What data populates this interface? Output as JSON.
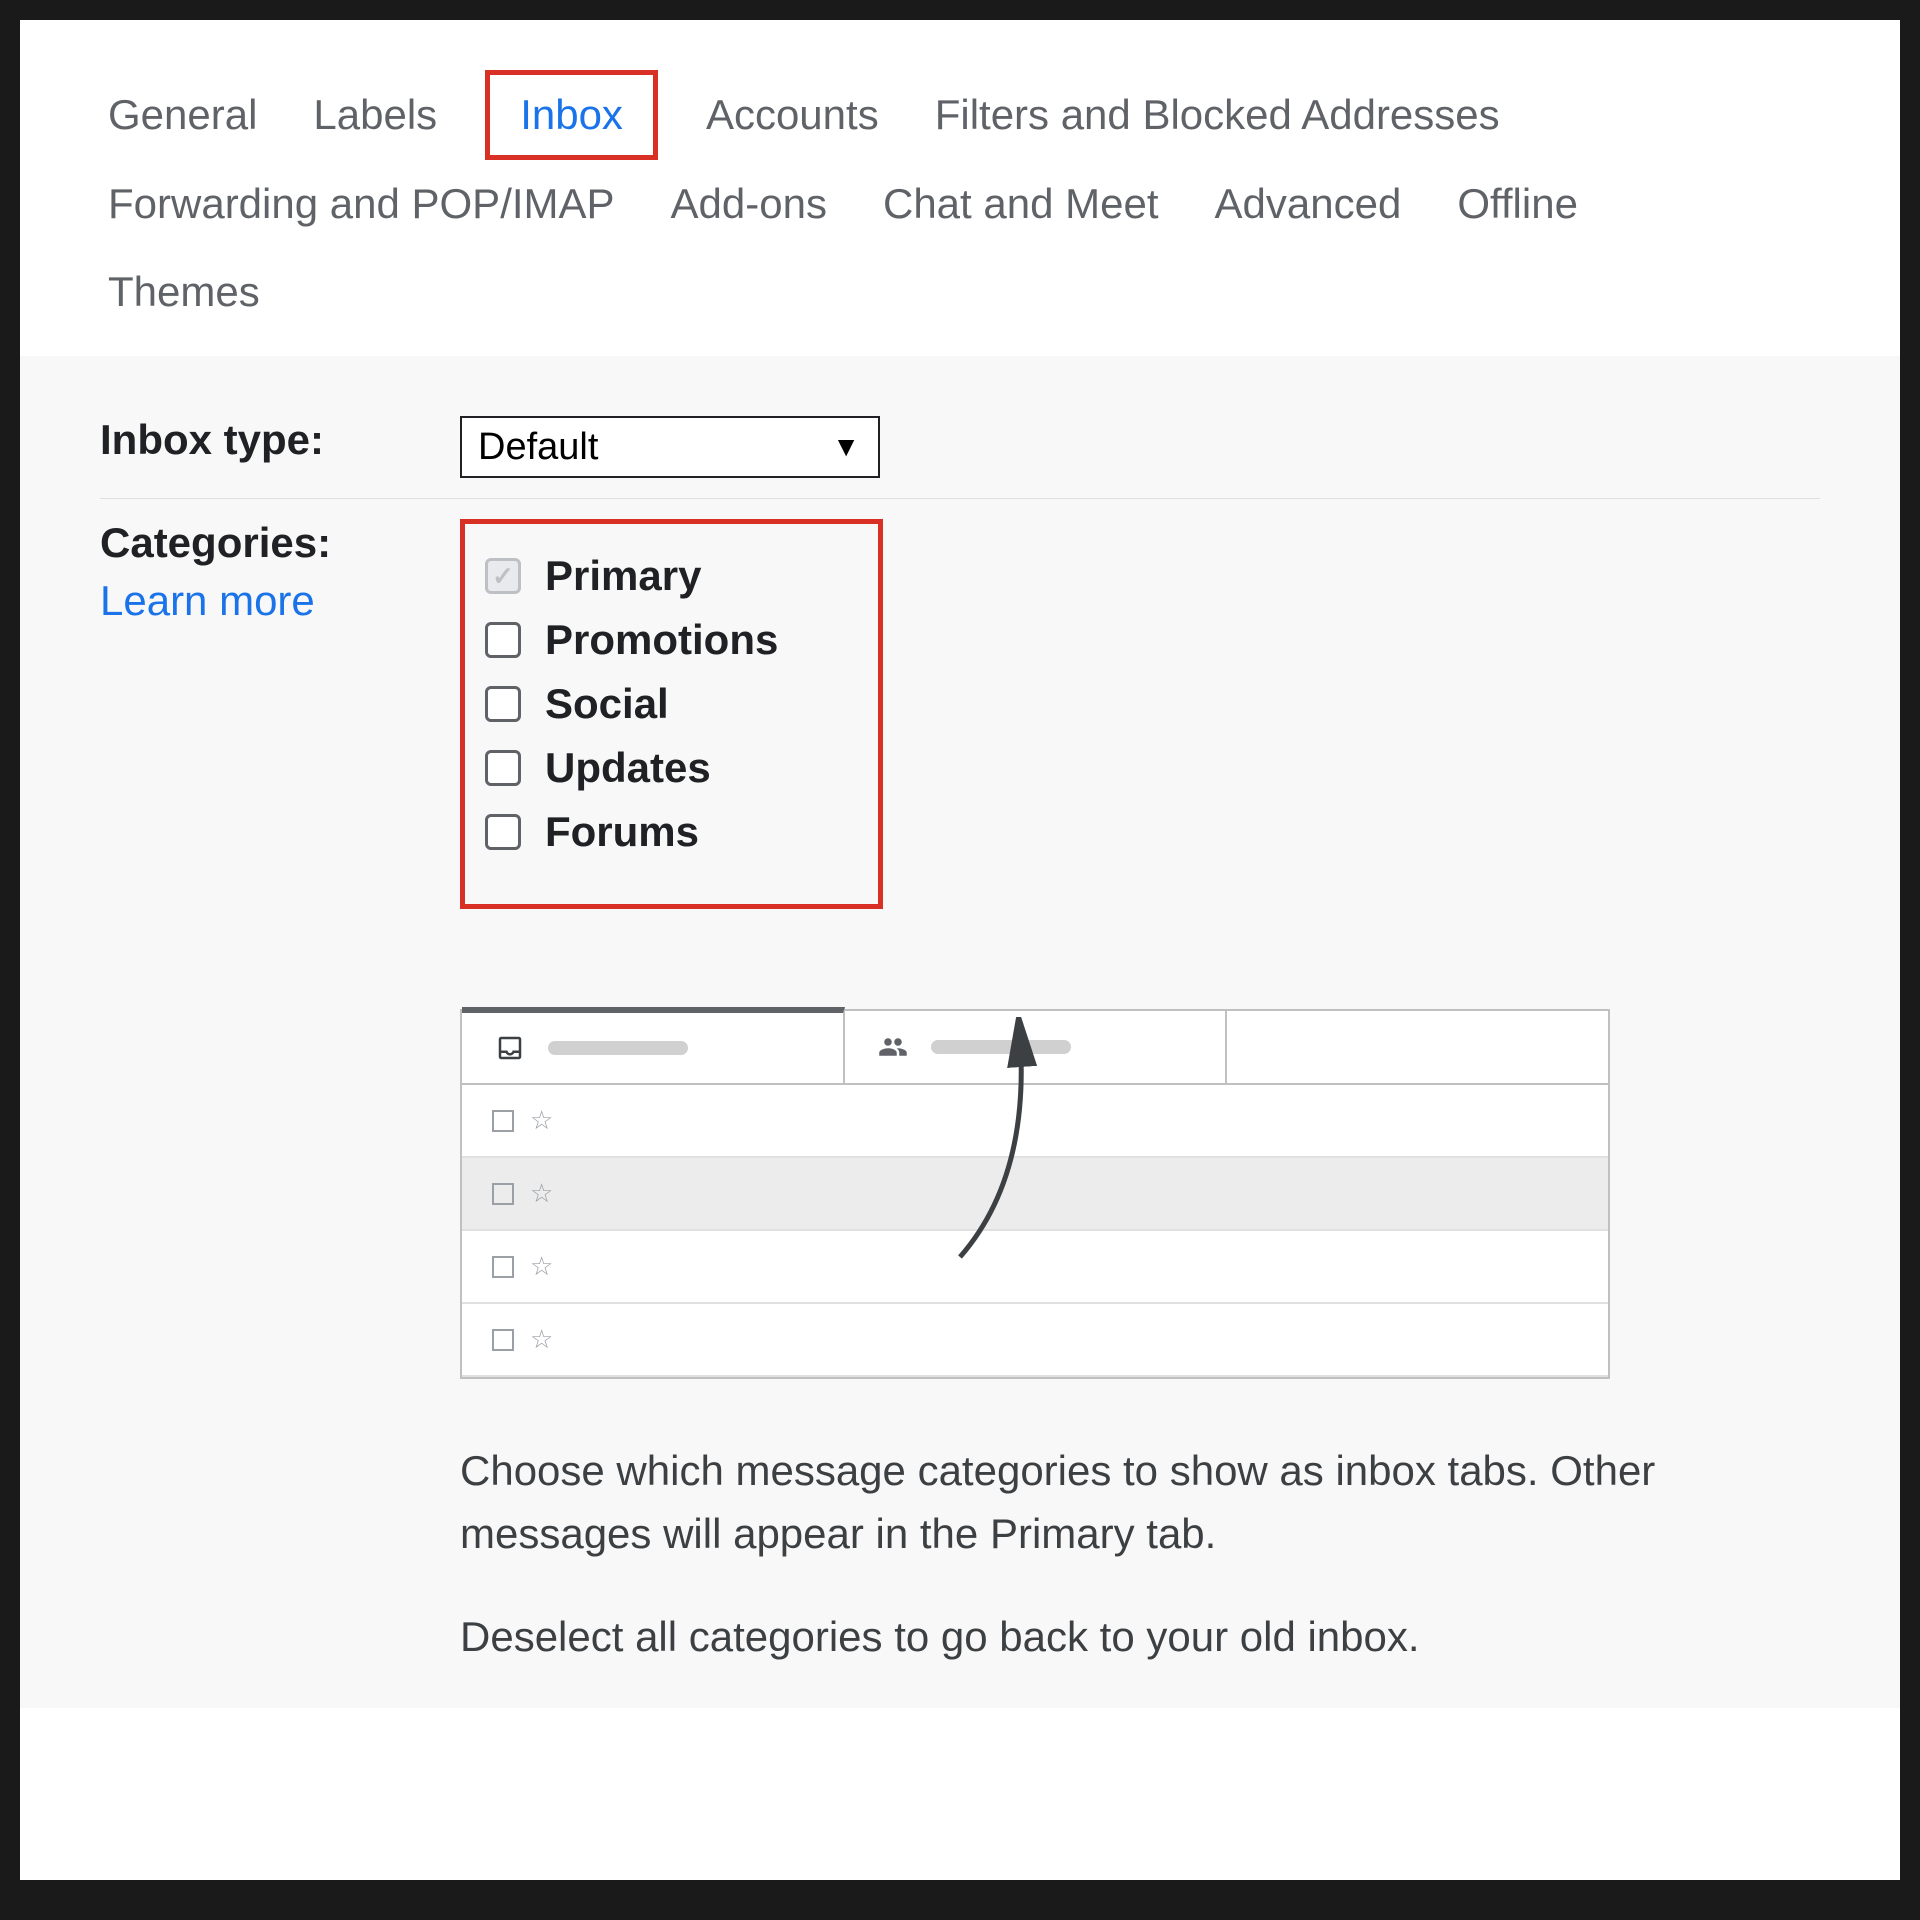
{
  "tabs": {
    "items": [
      {
        "label": "General",
        "active": false
      },
      {
        "label": "Labels",
        "active": false
      },
      {
        "label": "Inbox",
        "active": true
      },
      {
        "label": "Accounts",
        "active": false
      },
      {
        "label": "Filters and Blocked Addresses",
        "active": false
      },
      {
        "label": "Forwarding and POP/IMAP",
        "active": false
      },
      {
        "label": "Add-ons",
        "active": false
      },
      {
        "label": "Chat and Meet",
        "active": false
      },
      {
        "label": "Advanced",
        "active": false
      },
      {
        "label": "Offline",
        "active": false
      },
      {
        "label": "Themes",
        "active": false
      }
    ]
  },
  "inbox_type": {
    "label": "Inbox type:",
    "selected": "Default"
  },
  "categories": {
    "label": "Categories:",
    "learn_more": "Learn more",
    "items": [
      {
        "label": "Primary",
        "checked": true,
        "disabled": true
      },
      {
        "label": "Promotions",
        "checked": false,
        "disabled": false
      },
      {
        "label": "Social",
        "checked": false,
        "disabled": false
      },
      {
        "label": "Updates",
        "checked": false,
        "disabled": false
      },
      {
        "label": "Forums",
        "checked": false,
        "disabled": false
      }
    ]
  },
  "description": {
    "line1": "Choose which message categories to show as inbox tabs. Other messages will appear in the Primary tab.",
    "line2": "Deselect all categories to go back to your old inbox."
  }
}
